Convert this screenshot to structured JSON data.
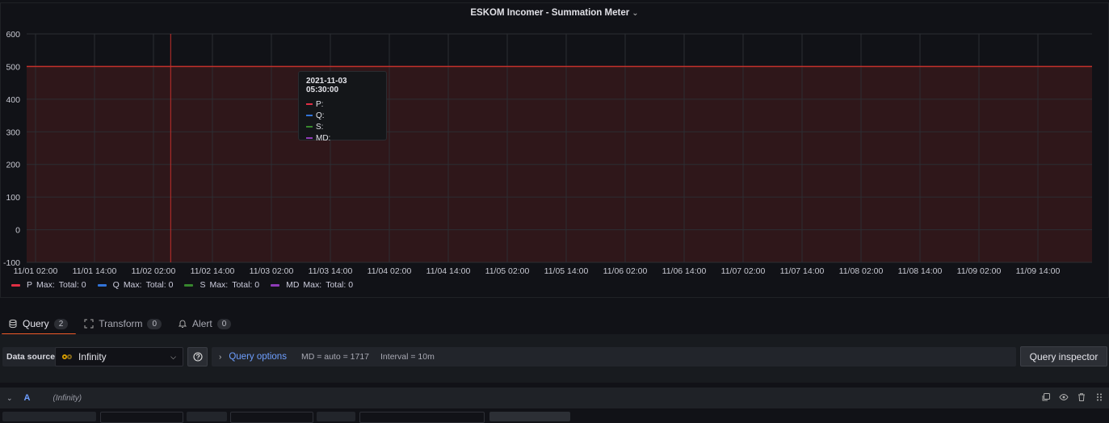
{
  "panel": {
    "title": "ESKOM Incomer - Summation Meter"
  },
  "chart_data": {
    "type": "area",
    "title": "ESKOM Incomer - Summation Meter",
    "ylim": [
      -100,
      600
    ],
    "yticks": [
      -100,
      0,
      100,
      200,
      300,
      400,
      500,
      600
    ],
    "xtick_labels": [
      "11/01 02:00",
      "11/01 14:00",
      "11/02 02:00",
      "11/02 14:00",
      "11/03 02:00",
      "11/03 14:00",
      "11/04 02:00",
      "11/04 14:00",
      "11/05 02:00",
      "11/05 14:00",
      "11/06 02:00",
      "11/06 14:00",
      "11/07 02:00",
      "11/07 14:00",
      "11/08 02:00",
      "11/08 14:00",
      "11/09 02:00",
      "11/09 14:00"
    ],
    "threshold": {
      "value": 500,
      "color": "#c4302b"
    },
    "grid": true,
    "series": [
      {
        "name": "P",
        "color": "#e02f44",
        "max": "Max:",
        "total": "Total: 0"
      },
      {
        "name": "Q",
        "color": "#3274d9",
        "max": "Max:",
        "total": "Total: 0"
      },
      {
        "name": "S",
        "color": "#37872d",
        "max": "Max:",
        "total": "Total: 0"
      },
      {
        "name": "MD",
        "color": "#8f3bb8",
        "max": "Max:",
        "total": "Total: 0"
      }
    ],
    "legend_placement": "bottom-left"
  },
  "tooltip": {
    "time": "2021-11-03 05:30:00",
    "rows": [
      "P:",
      "Q:",
      "S:",
      "MD:"
    ]
  },
  "tabs": [
    {
      "label": "Query",
      "count": "2",
      "icon": "database-icon"
    },
    {
      "label": "Transform",
      "count": "0",
      "icon": "transform-icon"
    },
    {
      "label": "Alert",
      "count": "0",
      "icon": "bell-icon"
    }
  ],
  "query_bar": {
    "datasource_label": "Data source",
    "datasource_value": "Infinity",
    "query_options_label": "Query options",
    "md_text": "MD = auto = 1717",
    "interval_text": "Interval = 10m",
    "inspector_label": "Query inspector"
  },
  "query_row": {
    "ref_id": "A",
    "datasource": "(Infinity)"
  }
}
